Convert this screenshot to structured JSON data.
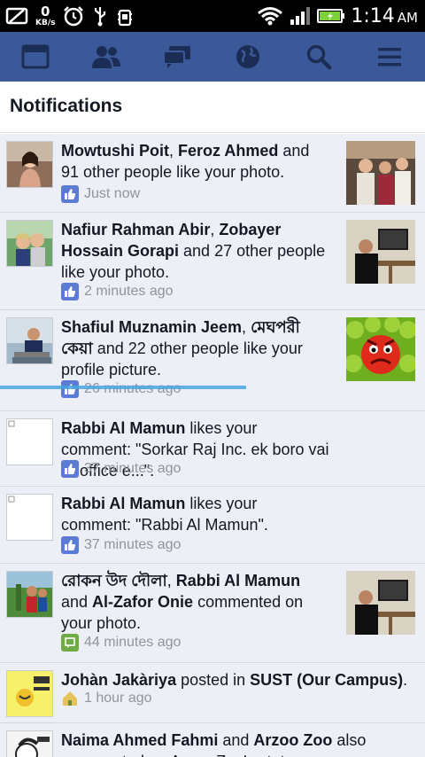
{
  "statusbar": {
    "speed_value": "0",
    "speed_unit": "KB/s",
    "time": "1:14",
    "ampm": "AM",
    "icons": [
      "photo-icon",
      "alarm-icon",
      "usb-icon",
      "debug-icon",
      "wifi-icon",
      "signal-icon",
      "battery-icon"
    ]
  },
  "nav": {
    "items": [
      "news-feed-icon",
      "friends-icon",
      "messages-icon",
      "globe-icon",
      "search-icon",
      "menu-icon"
    ]
  },
  "header": {
    "title": "Notifications"
  },
  "notifications": [
    {
      "actor1": "Mowtushi Poit",
      "sep1": ", ",
      "actor2": "Feroz Ahmed",
      "rest": " and 91 other people like your photo.",
      "time": "Just now",
      "icon": "like-icon"
    },
    {
      "actor1": "Nafiur Rahman Abir",
      "sep1": ", ",
      "actor2": "Zobayer Hossain Gorapi",
      "rest": " and 27 other people like your photo.",
      "time": "2 minutes ago",
      "icon": "like-icon"
    },
    {
      "actor1": "Shafiul Muznamin Jeem",
      "sep1": ", ",
      "actor2": "মেঘপরী কেয়া",
      "rest": " and 22 other people like your profile picture.",
      "time": "26 minutes ago",
      "icon": "like-icon"
    },
    {
      "actor1": "Rabbi Al Mamun",
      "rest": " likes your comment: \"Sorkar Raj Inc. ek boro vai er office e...\".",
      "time": "37 minutes ago",
      "icon": "like-icon"
    },
    {
      "actor1": "Rabbi Al Mamun",
      "rest": " likes your comment: \"Rabbi Al Mamun\".",
      "time": "37 minutes ago",
      "icon": "like-icon"
    },
    {
      "actor1": "রোকন উদ দৌলা",
      "sep1": ", ",
      "actor2": "Rabbi Al Mamun",
      "sep2": " and ",
      "actor3": "Al-Zafor Onie",
      "rest": " commented on your photo.",
      "time": "44 minutes ago",
      "icon": "comment-icon"
    },
    {
      "actor1": "Johàn Jakàriya",
      "sep1": " posted in ",
      "actor2": "SUST (Our Campus)",
      "rest": ".",
      "time": "1 hour ago",
      "icon": "group-icon"
    },
    {
      "actor1": "Naima Ahmed Fahmi",
      "sep1": " and ",
      "actor2": "Arzoo Zoo",
      "rest": " also commented on Arzoo Zoo's status.",
      "time": "",
      "icon": "comment-icon"
    }
  ],
  "colors": {
    "fb_blue": "#3b5998",
    "like_blue": "#5b7bd5",
    "comment_green": "#6fac46",
    "meta_gray": "#90949c"
  }
}
